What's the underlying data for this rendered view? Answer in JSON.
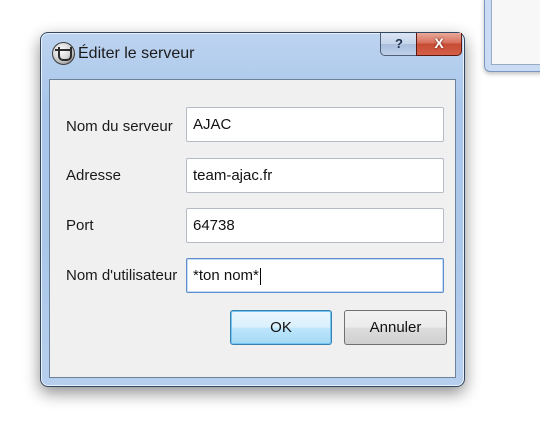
{
  "background_window": {},
  "dialog": {
    "title": "Éditer le serveur",
    "help_label": "?",
    "close_label": "X"
  },
  "form": {
    "server_name": {
      "label": "Nom du serveur",
      "value": "AJAC"
    },
    "address": {
      "label": "Adresse",
      "value": "team-ajac.fr"
    },
    "port": {
      "label": "Port",
      "value": "64738"
    },
    "username": {
      "label": "Nom d'utilisateur",
      "value": "*ton nom*"
    }
  },
  "buttons": {
    "ok_label": "OK",
    "cancel_label": "Annuler"
  },
  "colors": {
    "accent": "#3c7fb1",
    "close_red": "#c74b33",
    "frame_blue": "#aac7ea"
  },
  "icons": {
    "app": "mumble-app-icon",
    "help": "help-icon",
    "close": "close-icon"
  }
}
